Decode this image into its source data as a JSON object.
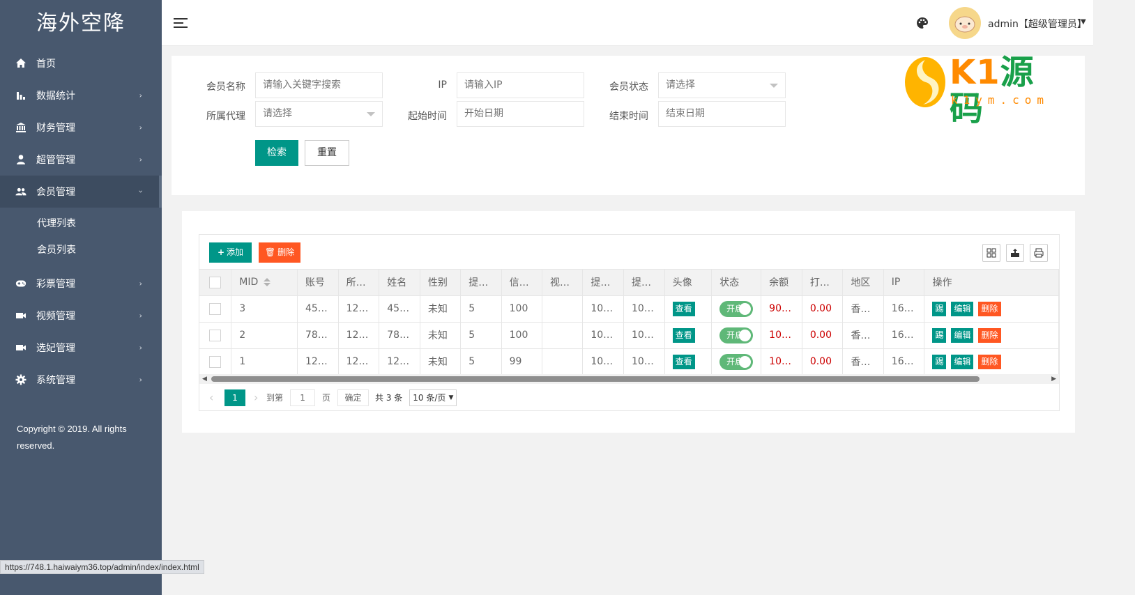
{
  "app": {
    "title": "海外空降"
  },
  "sidebar": {
    "items": [
      {
        "label": "首页",
        "icon": "home-icon",
        "arrow": ""
      },
      {
        "label": "数据统计",
        "icon": "bar-chart-icon",
        "arrow": "›"
      },
      {
        "label": "财务管理",
        "icon": "bank-icon",
        "arrow": "›"
      },
      {
        "label": "超管管理",
        "icon": "user-icon",
        "arrow": "›"
      },
      {
        "label": "会员管理",
        "icon": "users-icon",
        "arrow": "›"
      },
      {
        "label": "彩票管理",
        "icon": "gamepad-icon",
        "arrow": "›"
      },
      {
        "label": "视频管理",
        "icon": "video-icon",
        "arrow": "›"
      },
      {
        "label": "选妃管理",
        "icon": "video-icon",
        "arrow": "›"
      },
      {
        "label": "系统管理",
        "icon": "gear-icon",
        "arrow": "›"
      }
    ],
    "submenu": [
      "代理列表",
      "会员列表"
    ],
    "copyright": "Copyright © 2019. All rights reserved."
  },
  "header": {
    "user": "admin【超级管理员】"
  },
  "filter": {
    "member_name_label": "会员名称",
    "member_name_placeholder": "请输入关键字搜索",
    "ip_label": "IP",
    "ip_placeholder": "请输入IP",
    "status_label": "会员状态",
    "status_value": "请选择",
    "agent_label": "所属代理",
    "agent_value": "请选择",
    "start_label": "起始时间",
    "start_placeholder": "开始日期",
    "end_label": "结束时间",
    "end_placeholder": "结束日期",
    "search_button": "检索",
    "reset_button": "重置"
  },
  "watermark": {
    "brand_latin": "K1",
    "brand_cn": "源码",
    "url": "k1ym.com"
  },
  "toolbar": {
    "add_label": "添加",
    "delete_label": "删除"
  },
  "table": {
    "headers": [
      "MID",
      "账号",
      "所…",
      "姓名",
      "性别",
      "提…",
      "信…",
      "视…",
      "提…",
      "提…",
      "头像",
      "状态",
      "余额",
      "打…",
      "地区",
      "IP",
      "操作"
    ],
    "rows": [
      {
        "mid": "3",
        "account": "45…",
        "agent": "12…",
        "name": "45…",
        "gender": "未知",
        "c5": "5",
        "credit": "100",
        "c7": "",
        "c8": "10…",
        "c9": "10…",
        "avatar_btn": "查看",
        "status": "开启",
        "balance": "90…",
        "bet": "0.00",
        "region": "香…",
        "ip": "16…"
      },
      {
        "mid": "2",
        "account": "78…",
        "agent": "12…",
        "name": "78…",
        "gender": "未知",
        "c5": "5",
        "credit": "100",
        "c7": "",
        "c8": "10…",
        "c9": "10…",
        "avatar_btn": "查看",
        "status": "开启",
        "balance": "10…",
        "bet": "0.00",
        "region": "香…",
        "ip": "16…"
      },
      {
        "mid": "1",
        "account": "12…",
        "agent": "12…",
        "name": "12…",
        "gender": "未知",
        "c5": "5",
        "credit": "99",
        "c7": "",
        "c8": "10…",
        "c9": "10…",
        "avatar_btn": "查看",
        "status": "开启",
        "balance": "10…",
        "bet": "0.00",
        "region": "香…",
        "ip": "16…"
      }
    ],
    "actions": [
      "踢",
      "编辑",
      "删除"
    ]
  },
  "pager": {
    "current": "1",
    "goto_label": "到第",
    "goto_value": "1",
    "page_label": "页",
    "confirm": "确定",
    "total": "共 3 条",
    "size": "10 条/页"
  },
  "statusbar": {
    "url": "https://748.1.haiwaiym36.top/admin/index/index.html"
  },
  "colors": {
    "sidebar": "#48586e",
    "primary": "#009688",
    "danger": "#ff5722",
    "switch_on": "#5fb878",
    "balance_red": "#cc0000"
  }
}
